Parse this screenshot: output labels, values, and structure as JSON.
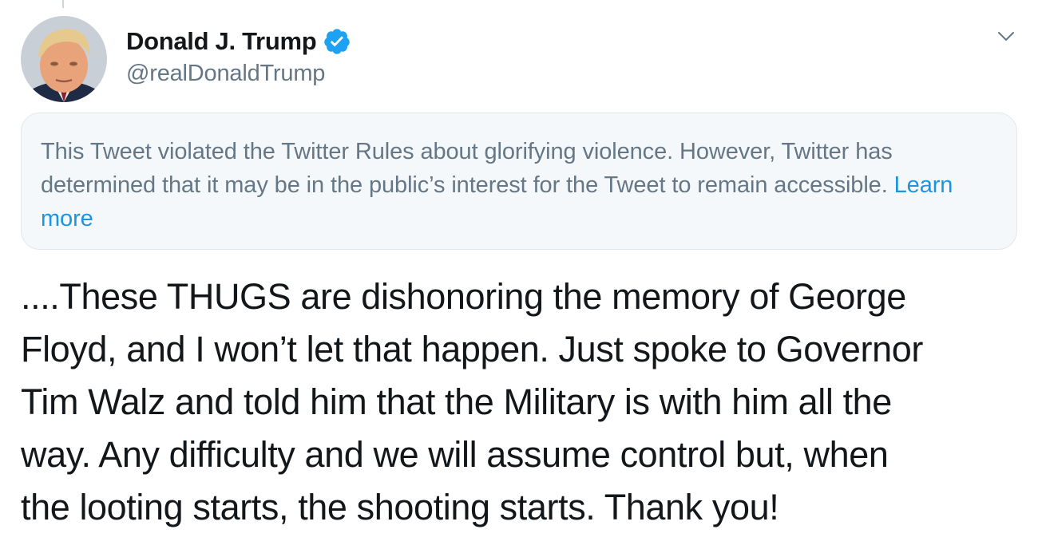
{
  "tweet": {
    "author": {
      "display_name": "Donald J. Trump",
      "handle": "@realDonaldTrump",
      "verified": true,
      "avatar_icon": "profile-photo"
    },
    "notice": {
      "text": "This Tweet violated the Twitter Rules about glorifying violence. However, Twitter has determined that it may be in the public’s interest for the Tweet to remain accessible.",
      "link_label": "Learn more"
    },
    "text_lines": [
      "....These THUGS are dishonoring the memory of George",
      "Floyd, and I won’t let that happen. Just spoke to Governor",
      "Tim Walz and told him that the Military is with him all the",
      "way. Any difficulty and we will assume control but, when",
      "the looting starts, the shooting starts. Thank you!"
    ],
    "menu_icon": "chevron-down-icon"
  },
  "colors": {
    "text_primary": "#14171a",
    "text_secondary": "#657786",
    "link": "#1b95e0",
    "verified_badge": "#1da1f2",
    "notice_background": "#f5f8fa",
    "notice_border": "#e1e8ed"
  }
}
